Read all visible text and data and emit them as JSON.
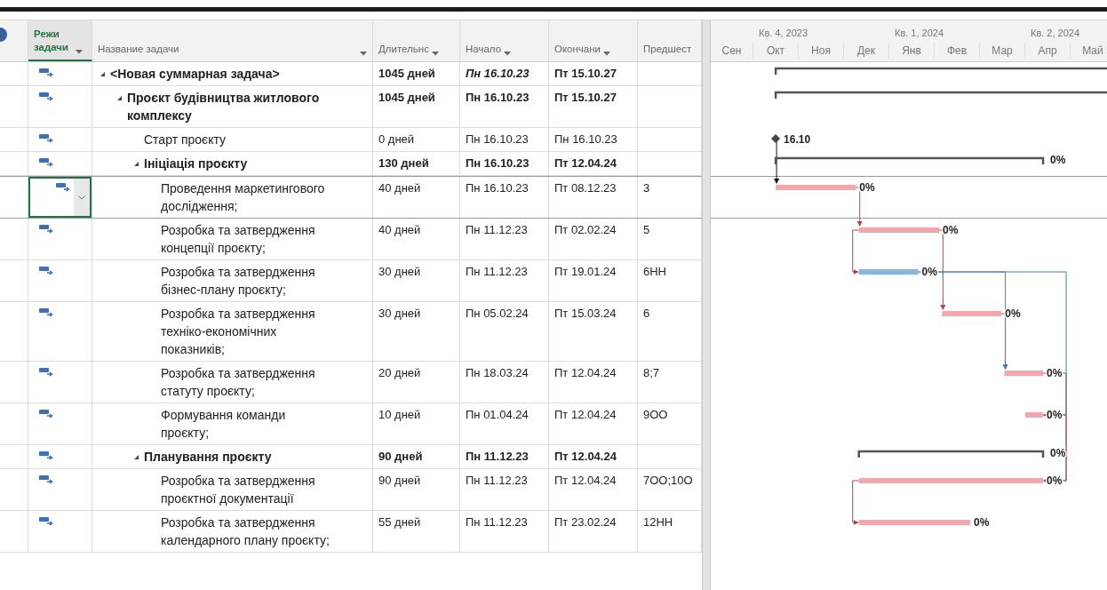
{
  "columns": [
    {
      "kind": "mode",
      "label": "Режи задачи",
      "selected": true,
      "filter": true
    },
    {
      "kind": "name",
      "label": "Название задачи",
      "selected": false,
      "filter": true
    },
    {
      "kind": "duration",
      "label": "Длительнс",
      "selected": false,
      "filter": true
    },
    {
      "kind": "start",
      "label": "Начало",
      "selected": false,
      "filter": true
    },
    {
      "kind": "finish",
      "label": "Окончани",
      "selected": false,
      "filter": true
    },
    {
      "kind": "predecessors",
      "label": "Предшест",
      "selected": false,
      "filter": false
    }
  ],
  "timeline": {
    "quarters": [
      "Кв. 4, 2023",
      "Кв. 1, 2024",
      "Кв. 2, 2024"
    ],
    "months": [
      "Сен",
      "Окт",
      "Ноя",
      "Дек",
      "Янв",
      "Фев",
      "Мар",
      "Апр",
      "Май"
    ]
  },
  "rows": [
    {
      "kind": "summary",
      "name": "<Новая суммарная задача>",
      "expanded": true,
      "selected": false,
      "duration": "1045 дней",
      "start": "Пн 16.10.23",
      "start_italic": true,
      "finish": "Пт 15.10.27",
      "children": [
        {
          "kind": "summary",
          "name": "Проєкт будівництва житлового комплексу",
          "expanded": true,
          "selected": false,
          "duration": "1045 дней",
          "start": "Пн 16.10.23",
          "start_italic": false,
          "finish": "Пт 15.10.27",
          "children": [
            {
              "kind": "milestone",
              "name": "Старт проєкту",
              "selected": false,
              "duration": "0 дней",
              "start": "Пн 16.10.23",
              "start_italic": false,
              "finish": "Пн 16.10.23",
              "bar_label": "16.10"
            },
            {
              "kind": "summary",
              "name": "Ініціація проєкту",
              "expanded": true,
              "selected": false,
              "duration": "130 дней",
              "start": "Пн 16.10.23",
              "start_italic": false,
              "finish": "Пт 12.04.24",
              "bar_label": "0%",
              "children": [
                {
                  "kind": "task",
                  "name": "Проведення маркетингового дослідження;",
                  "selected": true,
                  "critical": true,
                  "duration": "40 дней",
                  "start": "Пн 16.10.23",
                  "start_italic": false,
                  "finish": "Пт 08.12.23",
                  "predecessors": "3",
                  "bar_label": "0%"
                },
                {
                  "kind": "task",
                  "name": "Розробка та затвердження концепції проєкту;",
                  "selected": false,
                  "critical": true,
                  "duration": "40 дней",
                  "start": "Пн 11.12.23",
                  "start_italic": false,
                  "finish": "Пт 02.02.24",
                  "predecessors": "5",
                  "bar_label": "0%"
                },
                {
                  "kind": "task",
                  "name": "Розробка та затвердження бізнес-плану проєкту;",
                  "selected": false,
                  "critical": false,
                  "duration": "30 дней",
                  "start": "Пн 11.12.23",
                  "start_italic": false,
                  "finish": "Пт 19.01.24",
                  "predecessors": "6НН",
                  "bar_label": "0%"
                },
                {
                  "kind": "task",
                  "name": "Розробка та затвердження техніко-економічних показників;",
                  "selected": false,
                  "critical": true,
                  "duration": "30 дней",
                  "start": "Пн 05.02.24",
                  "start_italic": false,
                  "finish": "Пт 15.03.24",
                  "predecessors": "6",
                  "bar_label": "0%"
                },
                {
                  "kind": "task",
                  "name": "Розробка та затвердження статуту проєкту;",
                  "selected": false,
                  "critical": true,
                  "duration": "20 дней",
                  "start": "Пн 18.03.24",
                  "start_italic": false,
                  "finish": "Пт 12.04.24",
                  "predecessors": "8;7",
                  "bar_label": "0%"
                },
                {
                  "kind": "task",
                  "name": "Формування команди проєкту;",
                  "selected": false,
                  "critical": true,
                  "duration": "10 дней",
                  "start": "Пн 01.04.24",
                  "start_italic": false,
                  "finish": "Пт 12.04.24",
                  "predecessors": "9ОО",
                  "bar_label": "0%"
                }
              ]
            },
            {
              "kind": "summary",
              "name": "Планування проєкту",
              "expanded": true,
              "selected": false,
              "duration": "90 дней",
              "start": "Пн 11.12.23",
              "start_italic": false,
              "finish": "Пт 12.04.24",
              "bar_label": "0%",
              "children": [
                {
                  "kind": "task",
                  "name": "Розробка та затвердження проєктної документації",
                  "selected": false,
                  "critical": true,
                  "duration": "90 дней",
                  "start": "Пн 11.12.23",
                  "start_italic": false,
                  "finish": "Пт 12.04.24",
                  "predecessors": "7ОО;10О",
                  "bar_label": "0%"
                },
                {
                  "kind": "task",
                  "name": "Розробка та затвердження календарного плану проєкту;",
                  "selected": false,
                  "critical": true,
                  "duration": "55 дней",
                  "start": "Пн 11.12.23",
                  "start_italic": false,
                  "finish": "Пт 23.02.24",
                  "predecessors": "12НН",
                  "bar_label": "0%"
                }
              ]
            }
          ]
        }
      ]
    }
  ]
}
